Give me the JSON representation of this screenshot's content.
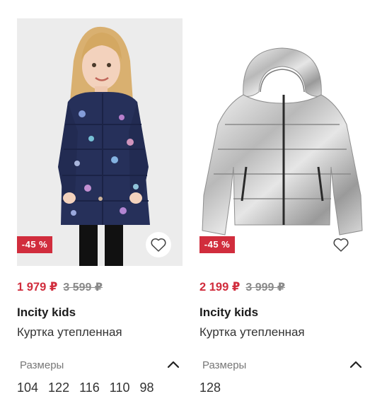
{
  "products": [
    {
      "discount": "-45 %",
      "price_new": "1 979 ₽",
      "price_old": "3 599 ₽",
      "brand": "Incity kids",
      "name": "Куртка утепленная",
      "sizes_label": "Размеры",
      "sizes": [
        "104",
        "122",
        "116",
        "110",
        "98"
      ]
    },
    {
      "discount": "-45 %",
      "price_new": "2 199 ₽",
      "price_old": "3 999 ₽",
      "brand": "Incity kids",
      "name": "Куртка утепленная",
      "sizes_label": "Размеры",
      "sizes": [
        "128"
      ]
    }
  ],
  "colors": {
    "discount_bg": "#d12d3d",
    "price_new": "#d12d3d",
    "price_old": "#8a8a8a"
  },
  "icons": {
    "favorite": "heart-outline-icon",
    "sizes_toggle": "chevron-up-icon"
  }
}
